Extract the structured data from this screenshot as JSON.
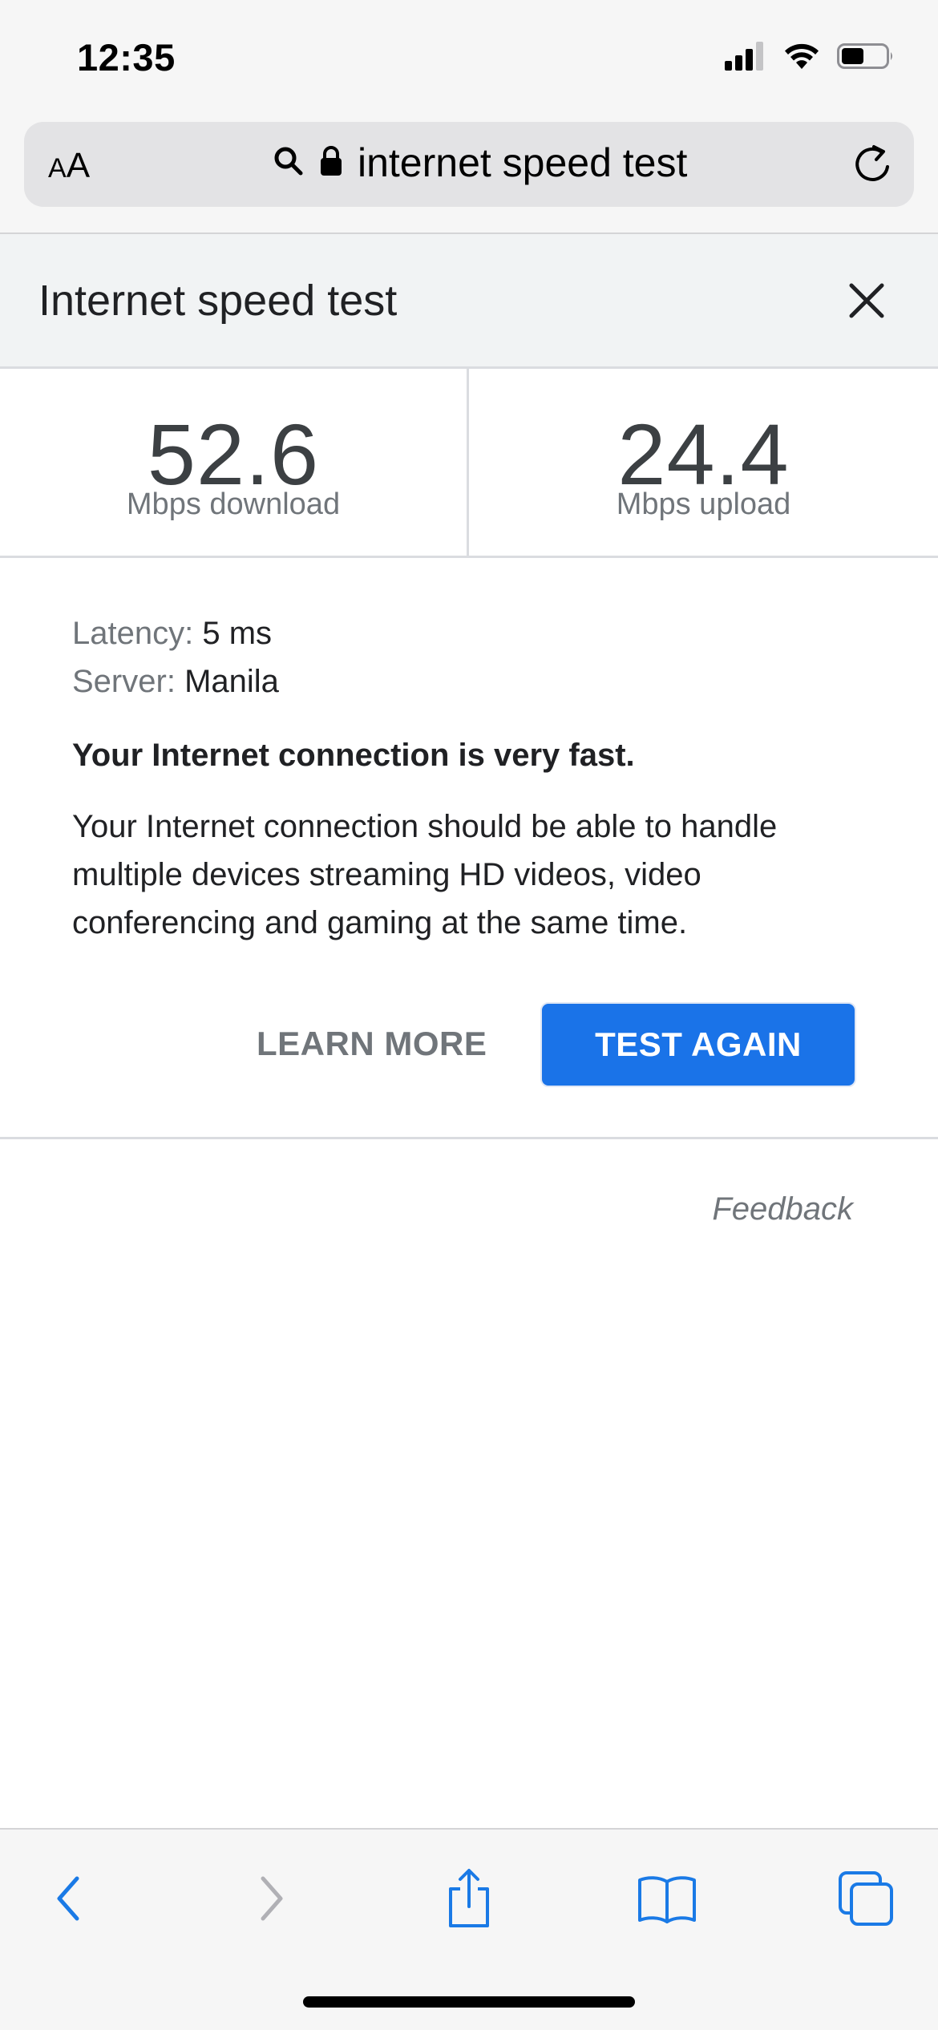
{
  "status_bar": {
    "time": "12:35"
  },
  "browser": {
    "text_size_button": {
      "small": "A",
      "large": "A"
    },
    "url_text": "internet speed test"
  },
  "panel": {
    "title": "Internet speed test",
    "download": {
      "value": "52.6",
      "label": "Mbps download"
    },
    "upload": {
      "value": "24.4",
      "label": "Mbps upload"
    },
    "latency": {
      "key": "Latency:",
      "value": "5 ms"
    },
    "server": {
      "key": "Server:",
      "value": "Manila"
    },
    "headline": "Your Internet connection is very fast.",
    "description": "Your Internet connection should be able to handle multiple devices streaming HD videos, video conferencing and gaming at the same time.",
    "learn_more_label": "LEARN MORE",
    "test_again_label": "TEST AGAIN",
    "feedback_label": "Feedback"
  },
  "toolbar": {
    "icons": [
      "back-icon",
      "forward-icon",
      "share-icon",
      "bookmarks-icon",
      "tabs-icon"
    ]
  },
  "colors": {
    "accent": "#1a73e8",
    "ios_blue": "#1a7ae6",
    "disabled": "#b0b0b5"
  }
}
